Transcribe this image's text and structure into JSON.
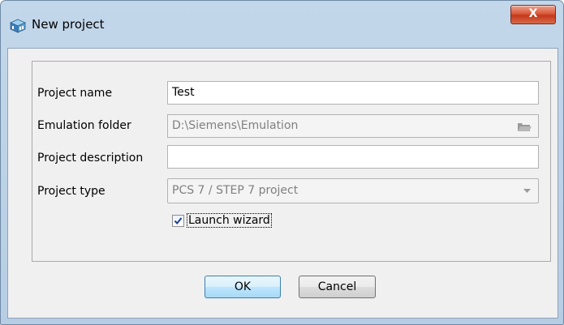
{
  "window": {
    "title": "New project",
    "close_label": "X",
    "icon": "project-cube-icon"
  },
  "form": {
    "project_name": {
      "label": "Project name",
      "value": "Test"
    },
    "emulation_folder": {
      "label": "Emulation folder",
      "value": "D:\\Siemens\\Emulation",
      "icon": "folder-icon"
    },
    "project_description": {
      "label": "Project description",
      "value": ""
    },
    "project_type": {
      "label": "Project type",
      "value": "PCS 7 / STEP 7 project"
    },
    "launch_wizard": {
      "label": "Launch wizard",
      "checked": true
    }
  },
  "buttons": {
    "ok": "OK",
    "cancel": "Cancel"
  },
  "colors": {
    "frame": "#b9cfe4",
    "client_bg": "#f0f0f0",
    "close_red": "#c9462a",
    "default_button": "#bee6fd"
  }
}
